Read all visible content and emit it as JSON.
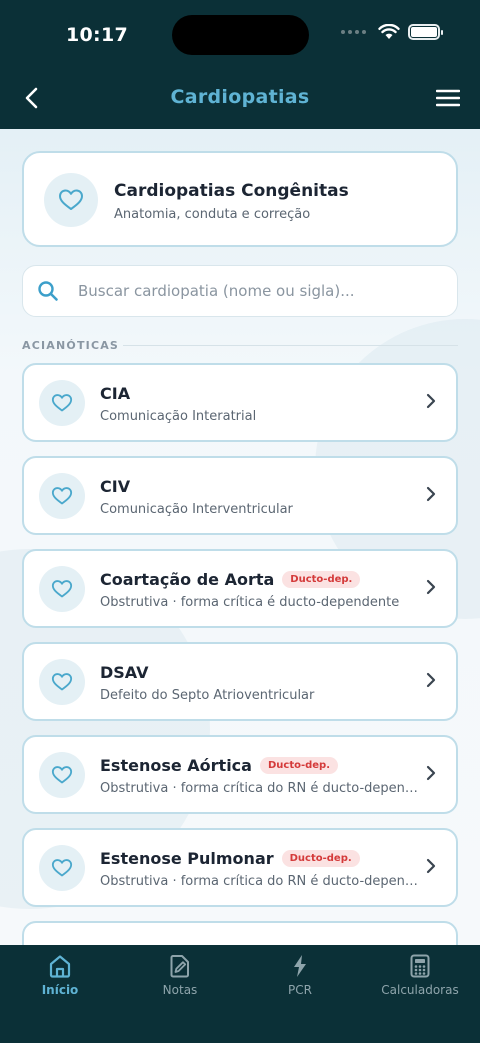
{
  "status_bar": {
    "time": "10:17"
  },
  "nav": {
    "title": "Cardiopatias"
  },
  "hero": {
    "title": "Cardiopatias Congênitas",
    "subtitle": "Anatomia, conduta e correção"
  },
  "search": {
    "placeholder": "Buscar cardiopatia (nome ou sigla)..."
  },
  "section": {
    "label": "ACIANÓTICAS"
  },
  "cards": [
    {
      "title": "CIA",
      "subtitle": "Comunicação Interatrial",
      "badge": ""
    },
    {
      "title": "CIV",
      "subtitle": "Comunicação Interventricular",
      "badge": ""
    },
    {
      "title": "Coartação de Aorta",
      "subtitle": "Obstrutiva · forma crítica é ducto-dependente",
      "badge": "Ducto-dep."
    },
    {
      "title": "DSAV",
      "subtitle": "Defeito do Septo Atrioventricular",
      "badge": ""
    },
    {
      "title": "Estenose Aórtica",
      "subtitle": "Obstrutiva · forma crítica do RN é ducto-dependente",
      "badge": "Ducto-dep."
    },
    {
      "title": "Estenose Pulmonar",
      "subtitle": "Obstrutiva · forma crítica do RN é ducto-dependente",
      "badge": "Ducto-dep."
    }
  ],
  "tabbar": {
    "tabs": [
      {
        "label": "Início",
        "icon": "home-icon",
        "active": true
      },
      {
        "label": "Notas",
        "icon": "notes-icon",
        "active": false
      },
      {
        "label": "PCR",
        "icon": "lightning-icon",
        "active": false
      },
      {
        "label": "Calculadoras",
        "icon": "calculator-icon",
        "active": false
      }
    ]
  },
  "colors": {
    "header_bg": "#0b3037",
    "accent": "#5fb3d4",
    "card_border": "#bfdde9",
    "badge_text": "#d43a3a",
    "badge_bg": "#fbe2e2"
  }
}
